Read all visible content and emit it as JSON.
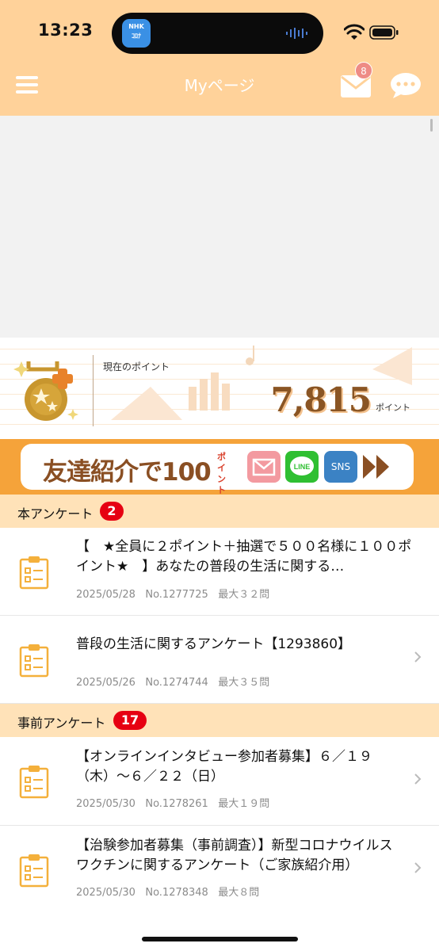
{
  "status_bar": {
    "time": "13:23",
    "app_icon_text": "NHK コロナ"
  },
  "header": {
    "title": "Myページ",
    "mail_badge": "8",
    "menu_icon": "hamburger-icon",
    "mail_icon": "mail-icon",
    "chat_icon": "chat-icon"
  },
  "points": {
    "label": "現在のポイント",
    "value": "7,815",
    "unit": "ポイント"
  },
  "referral": {
    "text": "友達紹介で100",
    "pt_label": "ポイント",
    "sns_label": "SNS",
    "line_label": "LINE"
  },
  "sections": [
    {
      "title": "本アンケート",
      "count": "2",
      "items": [
        {
          "title": "【　★全員に２ポイント＋抽選で５００名様に１００ポイント★　】あなたの普段の生活に関する…",
          "date": "2025/05/28",
          "number": "No.1277725",
          "max": "最大３２問"
        },
        {
          "title": "普段の生活に関するアンケート【1293860】",
          "date": "2025/05/26",
          "number": "No.1274744",
          "max": "最大３５問"
        }
      ]
    },
    {
      "title": "事前アンケート",
      "count": "17",
      "items": [
        {
          "title": "【オンラインインタビュー参加者募集】６／１９（木）～６／２２（日）",
          "date": "2025/05/30",
          "number": "No.1278261",
          "max": "最大１９問"
        },
        {
          "title": "【治験参加者募集（事前調査）】新型コロナウイルスワクチンに関するアンケート（ご家族紹介用）",
          "date": "2025/05/30",
          "number": "No.1278348",
          "max": "最大８問"
        }
      ]
    }
  ],
  "colors": {
    "header_bg": "#ffd29a",
    "section_bg": "#ffe2b8",
    "badge_red": "#e60012",
    "points_brown": "#8a5524",
    "referral_orange": "#f5a33a"
  }
}
